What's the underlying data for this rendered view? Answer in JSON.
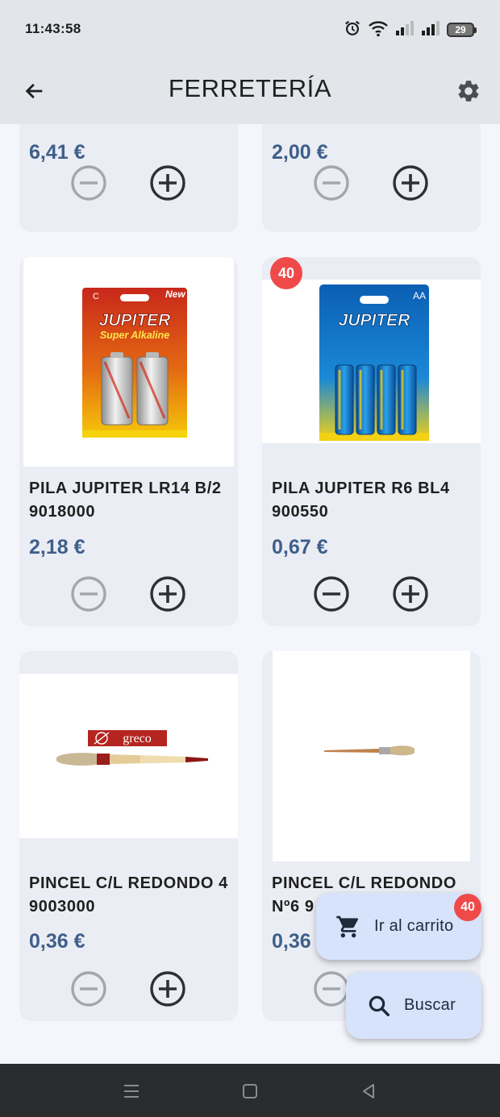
{
  "status_bar": {
    "time": "11:43:58",
    "battery_level": "29",
    "icons": [
      "alarm-icon",
      "wifi-icon",
      "signal-icon",
      "signal-icon",
      "battery-icon"
    ]
  },
  "app_bar": {
    "title": "FERRETERÍA",
    "back_icon": "arrow-left-icon",
    "settings_icon": "gear-icon"
  },
  "products": [
    {
      "name": "",
      "price": "6,41 €",
      "badge": null,
      "minus_enabled": false
    },
    {
      "name": "",
      "price": "2,00 €",
      "badge": null,
      "minus_enabled": false
    },
    {
      "name": "PILA JUPITER LR14 B/2 9018000",
      "price": "2,18 €",
      "badge": null,
      "minus_enabled": false,
      "image": "battery-pack-c"
    },
    {
      "name": "PILA JUPITER R6 BL4 900550",
      "price": "0,67 €",
      "badge": "40",
      "minus_enabled": true,
      "image": "battery-pack-aa"
    },
    {
      "name": "PINCEL C/L REDONDO 4 9003000",
      "price": "0,36 €",
      "badge": null,
      "minus_enabled": false,
      "image": "paintbrush-greco"
    },
    {
      "name": "PINCEL C/L REDONDO Nº6 9",
      "price": "0,36",
      "badge": null,
      "minus_enabled": false,
      "image": "paintbrush"
    }
  ],
  "product_images": {
    "c_pack": {
      "size": "C",
      "brand": "JUPITER",
      "tagline": "Super Alkaline",
      "new_label": "New"
    },
    "aa_pack": {
      "size": "AA",
      "brand": "JUPITER"
    },
    "brush_logo": "greco"
  },
  "fabs": {
    "cart": {
      "label": "Ir al carrito",
      "badge": "40",
      "icon": "cart-icon"
    },
    "search": {
      "label": "Buscar",
      "icon": "search-icon"
    }
  },
  "colors": {
    "app_bar_bg": "#e2e5ea",
    "card_bg": "#ebedf4",
    "price": "#3e5f8a",
    "badge": "#ef4a49",
    "fab_bg": "#d6e3fb",
    "nav_bg": "#2b2c2e"
  }
}
